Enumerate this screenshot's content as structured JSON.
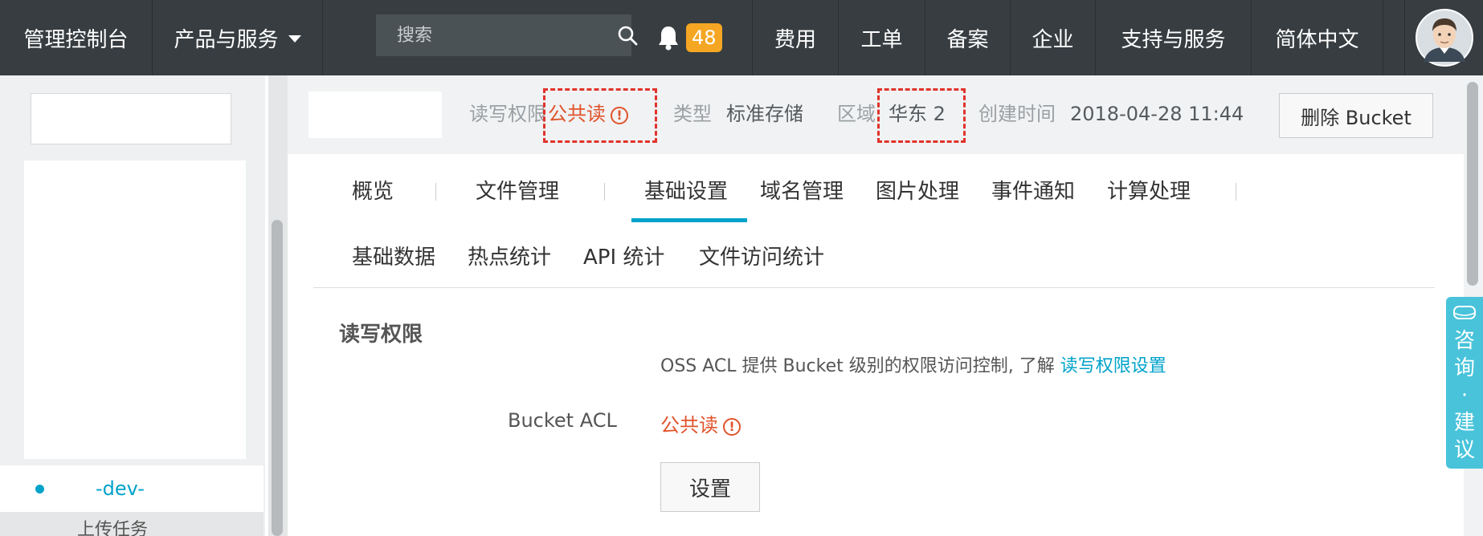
{
  "topbar": {
    "console": "管理控制台",
    "products": "产品与服务",
    "search_placeholder": "搜索",
    "notification_count": "48",
    "nav_items": [
      "费用",
      "工单",
      "备案",
      "企业",
      "支持与服务",
      "简体中文"
    ]
  },
  "sidebar": {
    "active_item": "-dev-",
    "sub_item": "上传任务"
  },
  "infobar": {
    "acl_label": "读写权限",
    "acl_value": "公共读",
    "type_label": "类型",
    "type_value": "标准存储",
    "region_label": "区域",
    "region_value": "华东 2",
    "created_label": "创建时间",
    "created_value": "2018-04-28 11:44",
    "delete_button": "删除 Bucket"
  },
  "tabs": {
    "row1": [
      "概览",
      "文件管理",
      "基础设置",
      "域名管理",
      "图片处理",
      "事件通知",
      "计算处理"
    ],
    "row2": [
      "基础数据",
      "热点统计",
      "API 统计",
      "文件访问统计"
    ],
    "active": "基础设置"
  },
  "section": {
    "title": "读写权限",
    "desc": "OSS ACL 提供 Bucket 级别的权限访问控制, 了解",
    "desc_link": "读写权限设置",
    "acl_label": "Bucket ACL",
    "acl_value": "公共读",
    "set_button": "设置"
  },
  "consult": {
    "text": "咨询·建议"
  },
  "colors": {
    "topbar_bg": "#373d41",
    "accent": "#00a2ca",
    "warning": "#e0542c",
    "badge": "#f5a623",
    "consult_tab": "#48c3da"
  },
  "icons": [
    "search-icon",
    "bell-icon",
    "caret-down-icon",
    "avatar",
    "warning-icon",
    "chat-icon"
  ]
}
